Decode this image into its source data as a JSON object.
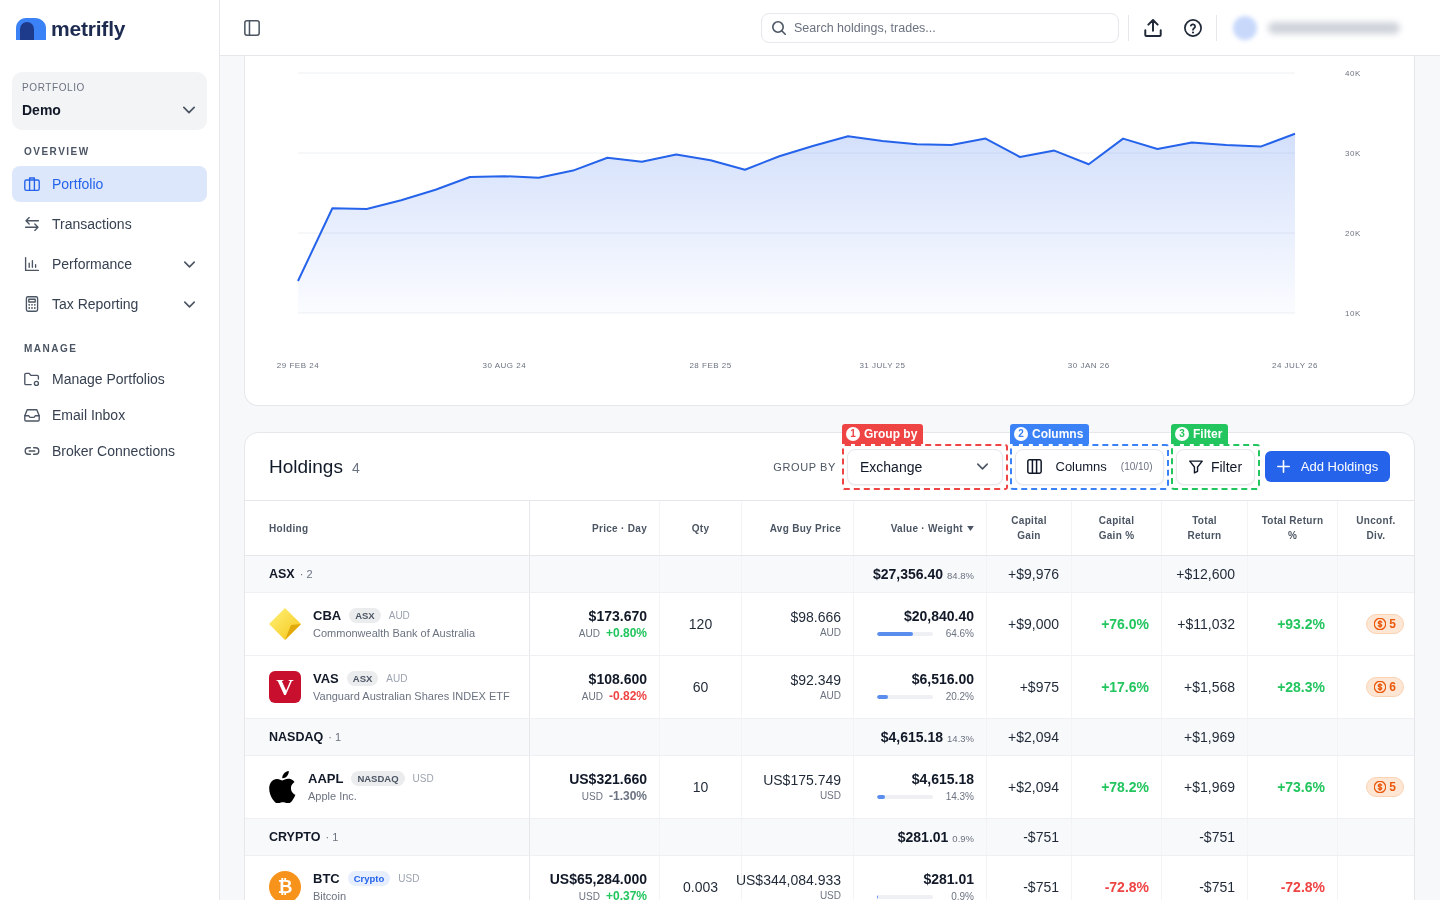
{
  "sidebar": {
    "brand": "metrifly",
    "portfolio_picker": {
      "label": "PORTFOLIO",
      "value": "Demo"
    },
    "sections": [
      {
        "title": "OVERVIEW",
        "items": [
          {
            "label": "Portfolio",
            "kind": "link",
            "selected": true
          },
          {
            "label": "Transactions",
            "kind": "link",
            "selected": false
          },
          {
            "label": "Performance",
            "kind": "submenu",
            "selected": false,
            "expanded": false
          },
          {
            "label": "Tax Reporting",
            "kind": "submenu",
            "selected": false,
            "expanded": false
          }
        ]
      },
      {
        "title": "MANAGE",
        "items": [
          {
            "label": "Manage Portfolios",
            "kind": "link",
            "selected": false
          },
          {
            "label": "Email Inbox",
            "kind": "link",
            "selected": false
          },
          {
            "label": "Broker Connections",
            "kind": "link",
            "selected": false
          }
        ]
      }
    ]
  },
  "header": {
    "search": {
      "placeholder": "Search holdings, trades..."
    }
  },
  "chart": {
    "chart_data": {
      "type": "area",
      "categories": [
        "29 FEB 24",
        null,
        null,
        null,
        null,
        null,
        "30 AUG 24",
        null,
        null,
        null,
        null,
        null,
        "28 FEB 25",
        null,
        null,
        null,
        null,
        "31 JULY 25",
        null,
        null,
        null,
        null,
        null,
        "30 JAN 26",
        null,
        null,
        null,
        null,
        null,
        "24 JULY 26"
      ],
      "series": [
        {
          "color": "#2563eb",
          "values": [
            14000,
            23100,
            23000,
            24100,
            25400,
            27000,
            27100,
            26900,
            27800,
            29400,
            28900,
            29800,
            29100,
            27900,
            29600,
            30900,
            32100,
            31500,
            31100,
            31000,
            31800,
            29500,
            30300,
            28600,
            31800,
            30500,
            31300,
            31000,
            30800,
            32400
          ]
        }
      ],
      "ylim": [
        10000,
        40000
      ],
      "yticks": [
        {
          "value": 10000,
          "label": "10K"
        },
        {
          "value": 20000,
          "label": "20K"
        },
        {
          "value": 30000,
          "label": "30K"
        },
        {
          "value": 40000,
          "label": "40K"
        }
      ]
    }
  },
  "holdings": {
    "title": "Holdings",
    "count": "4",
    "toolbar": [
      {
        "kind": "group_by",
        "label": "GROUP BY",
        "value": "Exchange",
        "annotation": {
          "number": "1",
          "label": "Group by",
          "color": "#ef4444"
        }
      },
      {
        "kind": "columns",
        "label": "Columns",
        "count": "(10/10)",
        "annotation": {
          "number": "2",
          "label": "Columns",
          "color": "#3b82f6"
        }
      },
      {
        "kind": "filter",
        "label": "Filter",
        "annotation": {
          "number": "3",
          "label": "Filter",
          "color": "#22c55e"
        }
      },
      {
        "kind": "add",
        "label": "Add Holdings"
      }
    ],
    "table": {
      "columns": [
        {
          "label": "Holding",
          "sorted": false
        },
        {
          "label": "Price · Day",
          "sorted": false
        },
        {
          "label": "Qty",
          "sorted": false
        },
        {
          "label": "Avg Buy Price",
          "sorted": false
        },
        {
          "label": "Value · Weight",
          "sorted": true
        },
        {
          "label": "Capital Gain",
          "sorted": false
        },
        {
          "label": "Capital Gain %",
          "sorted": false
        },
        {
          "label": "Total Return",
          "sorted": false
        },
        {
          "label": "Total Return %",
          "sorted": false
        },
        {
          "label": "Unconf. Div.",
          "sorted": false
        }
      ],
      "groups": [
        {
          "name": "ASX",
          "count": "· 2",
          "value": "$27,356.40",
          "weight": "84.8%",
          "capital_gain": "+$9,976",
          "total_return": "+$12,600",
          "rows": [
            {
              "symbol": "CBA",
              "exchange": {
                "text": "ASX",
                "color": "#4b5563"
              },
              "currency": "AUD",
              "name": "Commonwealth Bank of Australia",
              "logo": {
                "kind": "diamond"
              },
              "price": "$173.670",
              "price_currency": "AUD",
              "day_change": {
                "text": "+0.80%",
                "color": "#22c55e"
              },
              "qty": "120",
              "avg_buy_price": "$98.666",
              "avg_buy_currency": "AUD",
              "value": "$20,840.40",
              "weight": {
                "text": "64.6%",
                "level": 0.646
              },
              "capital_gain": "+$9,000",
              "capital_gain_pct": {
                "text": "+76.0%",
                "color": "#22c55e"
              },
              "total_return": "+$11,032",
              "total_return_pct": {
                "text": "+93.2%",
                "color": "#22c55e"
              },
              "unconfirmed_dividends": "5"
            },
            {
              "symbol": "VAS",
              "exchange": {
                "text": "ASX",
                "color": "#4b5563"
              },
              "currency": "AUD",
              "name": "Vanguard Australian Shares INDEX ETF",
              "logo": {
                "kind": "tile",
                "text": "V"
              },
              "price": "$108.600",
              "price_currency": "AUD",
              "day_change": {
                "text": "-0.82%",
                "color": "#ef4444"
              },
              "qty": "60",
              "avg_buy_price": "$92.349",
              "avg_buy_currency": "AUD",
              "value": "$6,516.00",
              "weight": {
                "text": "20.2%",
                "level": 0.202
              },
              "capital_gain": "+$975",
              "capital_gain_pct": {
                "text": "+17.6%",
                "color": "#22c55e"
              },
              "total_return": "+$1,568",
              "total_return_pct": {
                "text": "+28.3%",
                "color": "#22c55e"
              },
              "unconfirmed_dividends": "6"
            }
          ]
        },
        {
          "name": "NASDAQ",
          "count": "· 1",
          "value": "$4,615.18",
          "weight": "14.3%",
          "capital_gain": "+$2,094",
          "total_return": "+$1,969",
          "rows": [
            {
              "symbol": "AAPL",
              "exchange": {
                "text": "NASDAQ",
                "color": "#4b5563"
              },
              "currency": "USD",
              "name": "Apple Inc.",
              "logo": {
                "kind": "apple"
              },
              "price": "US$321.660",
              "price_currency": "USD",
              "day_change": {
                "text": "-1.30%",
                "color": "#6b7280"
              },
              "qty": "10",
              "avg_buy_price": "US$175.749",
              "avg_buy_currency": "USD",
              "value": "$4,615.18",
              "weight": {
                "text": "14.3%",
                "level": 0.143
              },
              "capital_gain": "+$2,094",
              "capital_gain_pct": {
                "text": "+78.2%",
                "color": "#22c55e"
              },
              "total_return": "+$1,969",
              "total_return_pct": {
                "text": "+73.6%",
                "color": "#22c55e"
              },
              "unconfirmed_dividends": "5"
            }
          ]
        },
        {
          "name": "CRYPTO",
          "count": "· 1",
          "value": "$281.01",
          "weight": "0.9%",
          "capital_gain": "-$751",
          "total_return": "-$751",
          "rows": [
            {
              "symbol": "BTC",
              "exchange": {
                "text": "Crypto",
                "color": "#2563eb"
              },
              "currency": "USD",
              "name": "Bitcoin",
              "logo": {
                "kind": "coin",
                "text": "₿"
              },
              "price": "US$65,284.000",
              "price_currency": "USD",
              "day_change": {
                "text": "+0.37%",
                "color": "#22c55e"
              },
              "qty": "0.003",
              "avg_buy_price": "US$344,084.933",
              "avg_buy_currency": "USD",
              "value": "$281.01",
              "weight": {
                "text": "0.9%",
                "level": 0.009
              },
              "capital_gain": "-$751",
              "capital_gain_pct": {
                "text": "-72.8%",
                "color": "#ef4444"
              },
              "total_return": "-$751",
              "total_return_pct": {
                "text": "-72.8%",
                "color": "#ef4444"
              }
            }
          ]
        }
      ]
    }
  }
}
